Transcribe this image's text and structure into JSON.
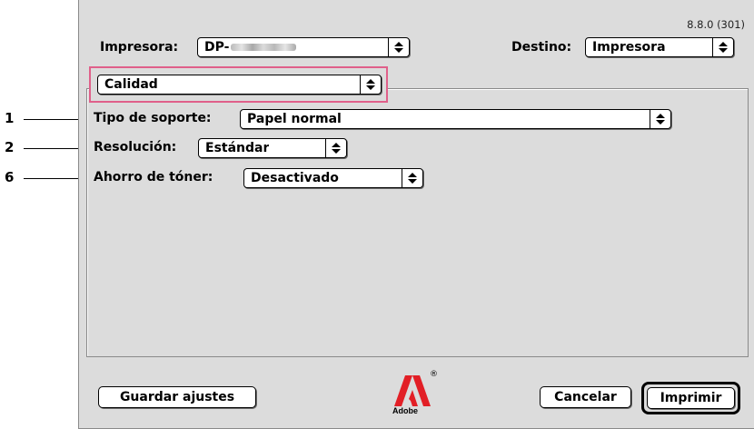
{
  "version": "8.8.0 (301)",
  "printer": {
    "label": "Impresora:",
    "value_prefix": "DP-"
  },
  "destination": {
    "label": "Destino:",
    "value": "Impresora"
  },
  "panel_menu": {
    "value": "Calidad"
  },
  "fields": [
    {
      "callout": "1",
      "label": "Tipo de soporte:",
      "value": "Papel normal"
    },
    {
      "callout": "2",
      "label": "Resolución:",
      "value": "Estándar"
    },
    {
      "callout": "6",
      "label": "Ahorro de tóner:",
      "value": "Desactivado"
    }
  ],
  "buttons": {
    "save_settings": "Guardar ajustes",
    "cancel": "Cancelar",
    "print": "Imprimir"
  },
  "logo": {
    "text": "Adobe",
    "mark": "®"
  },
  "colors": {
    "highlight": "#e0608a",
    "dialog_bg": "#dcdcdc",
    "logo_red": "#e21f26"
  }
}
